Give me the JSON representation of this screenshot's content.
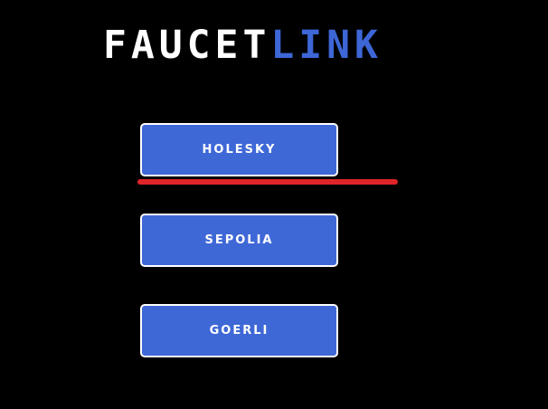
{
  "app": {
    "logo_part1": "FAUCET",
    "logo_part2": "LINK"
  },
  "networks": [
    {
      "label": "HOLESKY"
    },
    {
      "label": "SEPOLIA"
    },
    {
      "label": "GOERLI"
    }
  ],
  "colors": {
    "background": "#000000",
    "accent": "#3d66d6",
    "button_fill": "#3f68d7",
    "button_border": "#ffffff",
    "highlight_mark": "#e0242a"
  }
}
